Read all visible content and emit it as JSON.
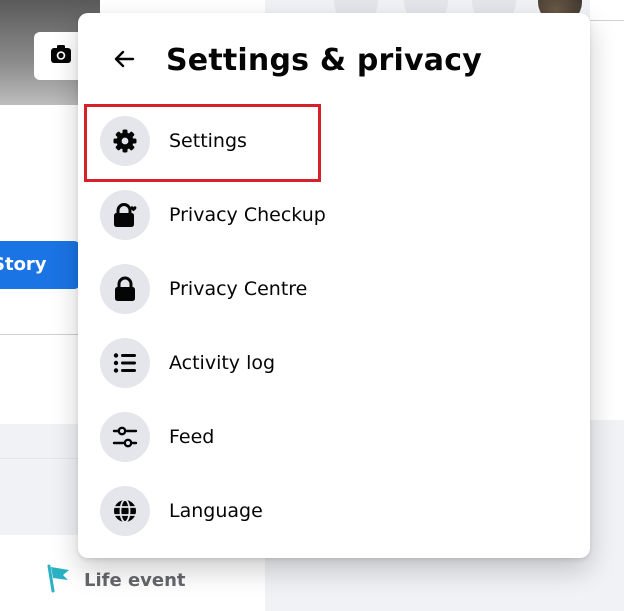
{
  "background": {
    "add_story_label": "Story",
    "life_event_label": "Life event"
  },
  "menu": {
    "title": "Settings & privacy",
    "items": [
      {
        "label": "Settings",
        "icon": "gear-icon"
      },
      {
        "label": "Privacy Checkup",
        "icon": "lock-heart-icon"
      },
      {
        "label": "Privacy Centre",
        "icon": "lock-icon"
      },
      {
        "label": "Activity log",
        "icon": "list-icon"
      },
      {
        "label": "Feed",
        "icon": "sliders-icon"
      },
      {
        "label": "Language",
        "icon": "globe-icon"
      }
    ],
    "highlighted_item": "Settings",
    "highlight_color": "#d6212a"
  },
  "colors": {
    "accent": "#1b74e4",
    "icon_bg": "#e4e6eb",
    "page_bg": "#f0f2f5"
  }
}
